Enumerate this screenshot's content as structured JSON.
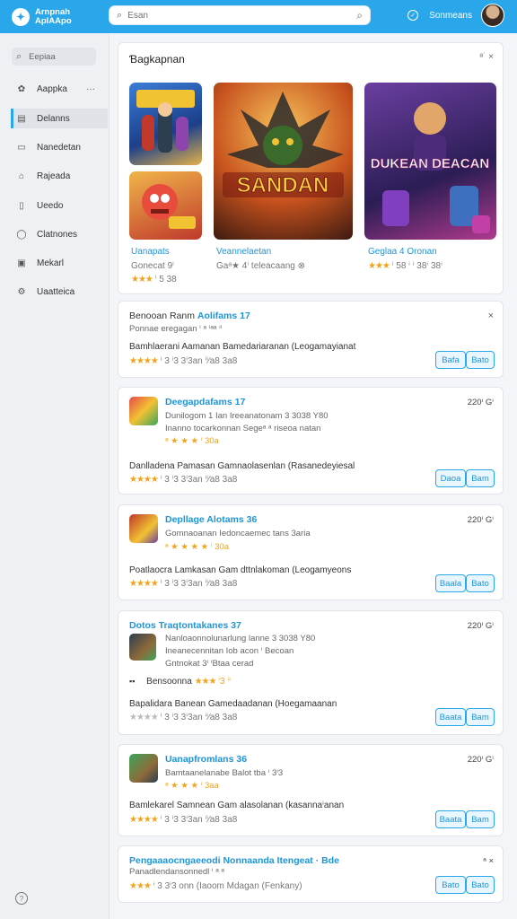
{
  "header": {
    "brand_line1": "Arnpnah",
    "brand_line2": "AplAApo",
    "search_placeholder": "Esan",
    "user_name": "Sonmeans"
  },
  "sidebar": {
    "search_label": "Eepiaa",
    "items": [
      {
        "label": "Aappka",
        "icon": "puzzle-icon"
      },
      {
        "label": "Delanns",
        "icon": "list-icon"
      },
      {
        "label": "Nanedetan",
        "icon": "card-icon"
      },
      {
        "label": "Rajeada",
        "icon": "store-icon"
      },
      {
        "label": "Ueedo",
        "icon": "tablet-icon"
      },
      {
        "label": "Clatnones",
        "icon": "globe-icon"
      },
      {
        "label": "Mekarl",
        "icon": "image-icon"
      },
      {
        "label": "Uaatteica",
        "icon": "gear-icon"
      }
    ]
  },
  "featured": {
    "title": "Ɓagkapnan",
    "controls": "ᵃ˙ ×",
    "tile1": {
      "name": "Uanapats",
      "sub": "Gonecat 9ⁱ",
      "stars": "★★★",
      "count": "ⁱ 5 38"
    },
    "tile2": {
      "name": "Veannelaetan",
      "sub": "Gaᵃ★ 4ⁱ teleacaang",
      "badge": "⊗"
    },
    "tile3": {
      "name": "Geglaa 4 Oronan",
      "stars": "★★★",
      "count": "ⁱ 58 ⁱ ⁱ 38ⁱ 38ⁱ"
    },
    "art_big": "SANDAN",
    "art_right": "DUKEAN DEACAN"
  },
  "cards": [
    {
      "title_a": "Benooan Ranm",
      "title_b": "Aolifams 17",
      "sub": "Ponnae eregagan ⁱ ᵃ ⁱᵃᵃ ⁱⁱ",
      "body": "Bamhlaerani Aamanan Bamedariaranan (Leogamayianat",
      "rating": "★★★★",
      "meta": "ⁱ 3 ⁱ3 3ⁱ3an ⁱⁱ⁄a8 3a8",
      "btn1": "Bafa",
      "btn2": "Bato"
    },
    {
      "title": "Deegapdafams 17",
      "date": "220ⁱ Gⁱ",
      "line1": "Dunilogom 1 Ian Ireeanatonam 3 3038 Y80",
      "line2": "Inanno tocarkonnan Segeᵃ ᵃ riseoa natan",
      "line3": "ᵃ ★ ★ ★ ⁱ 30a",
      "body": "Danlladena Pamasan Gamnaolasenlan (Rasanedeyiesal",
      "rating": "★★★★",
      "meta": "ⁱ 3 ⁱ3 3ⁱ3an ⁱⁱ⁄a8 3a8",
      "btn1": "Daoa",
      "btn2": "Bam"
    },
    {
      "title": "Depllage Alotams 36",
      "date": "220ⁱ Gⁱ",
      "line1": "Gomnaoanan Iedoncaemec tans 3aria",
      "line2": "ᵃ ★ ★ ★ ★ ⁱ 30a",
      "body": "Poatlaocra Lamkasan Gam dttnlakoman (Leogamyeons",
      "rating": "★★★★",
      "meta": "ⁱ 3 ⁱ3 3ⁱ3an ⁱⁱ⁄a8 3a8",
      "btn1": "Baala",
      "btn2": "Bato"
    },
    {
      "title_a": "Dotos",
      "title_b": "Traqtontakanes 37",
      "date": "220ⁱ Gⁱ",
      "line1": "Nanloaonnolunarlung lanne 3 3038 Y80",
      "line2": "Ineanecennitan Iob acon ⁱ Becoan",
      "line3": "Gntnokat 3ⁱ ⁱBtaa cerad",
      "line4": "Bensoonna",
      "line4_stars": "★★★",
      "line4_count": "ⁱ3 ⁱⁱ",
      "body": "Bapalidara Banean Gamedaadanan (Hoegamaanan",
      "rating": "★★★★",
      "meta": "ⁱ 3 ⁱ3 3ⁱ3an ⁱⁱ⁄a8 3a8",
      "btn1": "Baata",
      "btn2": "Bam"
    },
    {
      "title": "Uanapfromlans 36",
      "date": "220ⁱ Gⁱ",
      "line1": "Bamtaanelanabe Balot tba ⁱ 3ⁱ3",
      "line2": "ᵃ ★ ★ ★ ⁱ 3aa",
      "body": "Bamlekarel Samnean Gam alasolanan (kasannaⁱanan",
      "rating": "★★★★",
      "meta": "ⁱ 3 ⁱ3 3ⁱ3an ⁱⁱ⁄a8 3a8",
      "btn1": "Baata",
      "btn2": "Bam"
    },
    {
      "title_a": "Pengaaaocngaeeodi Nonnaanda Itengeat",
      "title_b": "· Bde",
      "sub": "Panadlendansonnedl ⁱ ᵃ ᵃ",
      "rating": "★★★",
      "meta": "ⁱ 3 3ⁱ3 onn (Iaoom Mdagan (Fenkany)",
      "btn1": "Bato",
      "btn2": "Bato",
      "controls": "ᵃ ×"
    }
  ],
  "colors": {
    "accent": "#2aa6ea",
    "link": "#1e95d9",
    "star": "#f2a31b"
  }
}
